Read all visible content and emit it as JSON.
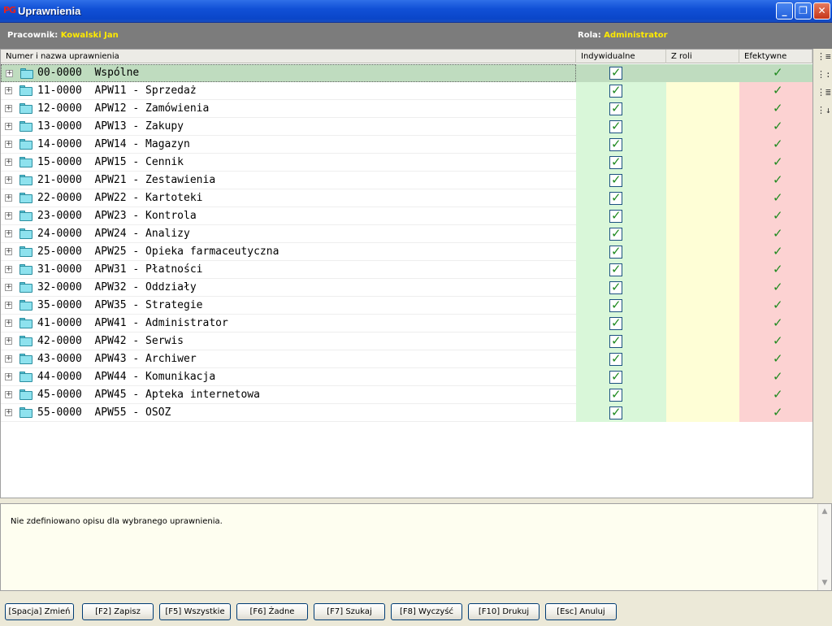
{
  "window": {
    "title": "Uprawnienia",
    "icon_text": "PG"
  },
  "info": {
    "employee_label": "Pracownik:",
    "employee_name": "Kowalski Jan",
    "role_label": "Rola:",
    "role_name": "Administrator"
  },
  "grid": {
    "columns": [
      "Numer i nazwa uprawnienia",
      "Indywidualne",
      "Z roli",
      "Efektywne"
    ],
    "rows": [
      {
        "label": "00-0000  Wspólne",
        "individual": true,
        "from_role": false,
        "effective": true,
        "selected": true
      },
      {
        "label": "11-0000  APW11 - Sprzedaż",
        "individual": true,
        "from_role": false,
        "effective": true
      },
      {
        "label": "12-0000  APW12 - Zamówienia",
        "individual": true,
        "from_role": false,
        "effective": true
      },
      {
        "label": "13-0000  APW13 - Zakupy",
        "individual": true,
        "from_role": false,
        "effective": true
      },
      {
        "label": "14-0000  APW14 - Magazyn",
        "individual": true,
        "from_role": false,
        "effective": true
      },
      {
        "label": "15-0000  APW15 - Cennik",
        "individual": true,
        "from_role": false,
        "effective": true
      },
      {
        "label": "21-0000  APW21 - Zestawienia",
        "individual": true,
        "from_role": false,
        "effective": true
      },
      {
        "label": "22-0000  APW22 - Kartoteki",
        "individual": true,
        "from_role": false,
        "effective": true
      },
      {
        "label": "23-0000  APW23 - Kontrola",
        "individual": true,
        "from_role": false,
        "effective": true
      },
      {
        "label": "24-0000  APW24 - Analizy",
        "individual": true,
        "from_role": false,
        "effective": true
      },
      {
        "label": "25-0000  APW25 - Opieka farmaceutyczna",
        "individual": true,
        "from_role": false,
        "effective": true
      },
      {
        "label": "31-0000  APW31 - Płatności",
        "individual": true,
        "from_role": false,
        "effective": true
      },
      {
        "label": "32-0000  APW32 - Oddziały",
        "individual": true,
        "from_role": false,
        "effective": true
      },
      {
        "label": "35-0000  APW35 - Strategie",
        "individual": true,
        "from_role": false,
        "effective": true
      },
      {
        "label": "41-0000  APW41 - Administrator",
        "individual": true,
        "from_role": false,
        "effective": true
      },
      {
        "label": "42-0000  APW42 - Serwis",
        "individual": true,
        "from_role": false,
        "effective": true
      },
      {
        "label": "43-0000  APW43 - Archiwer",
        "individual": true,
        "from_role": false,
        "effective": true
      },
      {
        "label": "44-0000  APW44 - Komunikacja",
        "individual": true,
        "from_role": false,
        "effective": true
      },
      {
        "label": "45-0000  APW45 - Apteka internetowa",
        "individual": true,
        "from_role": false,
        "effective": true
      },
      {
        "label": "55-0000  APW55 - OSOZ",
        "individual": true,
        "from_role": false,
        "effective": true
      }
    ]
  },
  "side_tools": [
    "expand-all-icon",
    "collapse-all-icon",
    "expand-level-icon",
    "sort-icon"
  ],
  "description": "Nie zdefiniowano opisu dla wybranego uprawnienia.",
  "buttons": [
    "[Spacja] Zmień",
    "[F2] Zapisz",
    "[F5] Wszystkie",
    "[F6] Żadne",
    "[F7] Szukaj",
    "[F8] Wyczyść",
    "[F10] Drukuj",
    "[Esc] Anuluj"
  ],
  "colors": {
    "individual_bg": "#d9f7d9",
    "role_bg": "#fefed6",
    "effective_bg": "#fcd2d2",
    "selected_bg": "#bfdcbf",
    "check": "#1f8a1f",
    "info_value": "#ffea00"
  }
}
